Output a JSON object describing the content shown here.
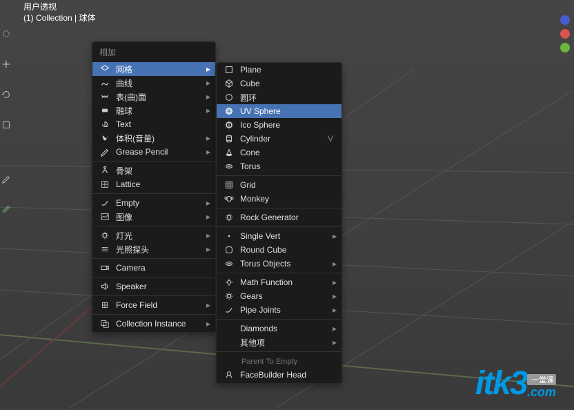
{
  "header": {
    "line1": "用户透视",
    "line2": "(1) Collection | 球体"
  },
  "menus": {
    "add": {
      "title": "相加",
      "items": [
        {
          "label": "网格"
        },
        {
          "label": "曲线"
        },
        {
          "label": "表(曲)面"
        },
        {
          "label": "融球"
        },
        {
          "label": "Text"
        },
        {
          "label": "体积(音量)"
        },
        {
          "label": "Grease Pencil"
        },
        {
          "label": "骨架"
        },
        {
          "label": "Lattice"
        },
        {
          "label": "Empty"
        },
        {
          "label": "图像"
        },
        {
          "label": "灯光"
        },
        {
          "label": "光照探头"
        },
        {
          "label": "Camera"
        },
        {
          "label": "Speaker"
        },
        {
          "label": "Force Field"
        },
        {
          "label": "Collection Instance"
        }
      ]
    },
    "mesh": {
      "heading": "Parent To Empty",
      "items": [
        {
          "label": "Plane"
        },
        {
          "label": "Cube"
        },
        {
          "label": "圆环"
        },
        {
          "label": "UV Sphere"
        },
        {
          "label": "Ico Sphere"
        },
        {
          "label": "Cylinder",
          "shortcut": "V"
        },
        {
          "label": "Cone"
        },
        {
          "label": "Torus"
        },
        {
          "label": "Grid"
        },
        {
          "label": "Monkey"
        },
        {
          "label": "Rock Generator"
        },
        {
          "label": "Single Vert"
        },
        {
          "label": "Round Cube"
        },
        {
          "label": "Torus Objects"
        },
        {
          "label": "Math Function"
        },
        {
          "label": "Gears"
        },
        {
          "label": "Pipe Joints"
        },
        {
          "label": "Diamonds"
        },
        {
          "label": "其他项"
        },
        {
          "label": "FaceBuilder Head"
        }
      ]
    }
  },
  "watermark": {
    "brand": "itk3",
    "tag": "一堂课",
    "tld": ".com"
  },
  "colors": {
    "highlight": "#4772b3",
    "menuBg": "#1b1b1b",
    "axisX": "#d9534f",
    "axisY": "#6eb53f",
    "axisZ": "#465dcc",
    "watermark": "#0099e6"
  }
}
